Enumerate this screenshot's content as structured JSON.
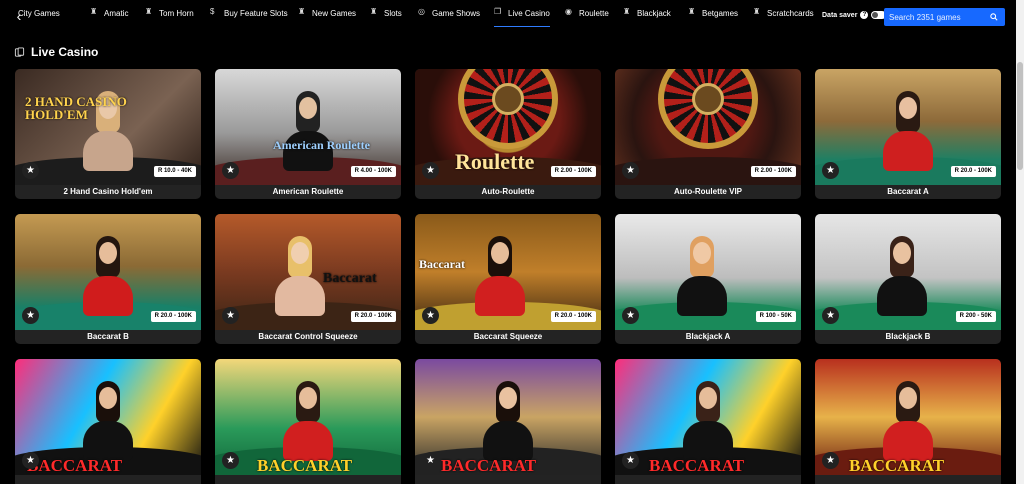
{
  "nav": {
    "back_icon": "chevron-left-icon",
    "items": [
      {
        "label": "City Games",
        "icon": "city-icon"
      },
      {
        "label": "Amatic",
        "icon": "trophy-icon"
      },
      {
        "label": "Tom Horn",
        "icon": "trophy-icon"
      },
      {
        "label": "Buy Feature Slots",
        "icon": "dollar-icon"
      },
      {
        "label": "New Games",
        "icon": "trophy-icon"
      },
      {
        "label": "Slots",
        "icon": "trophy-icon"
      },
      {
        "label": "Game Shows",
        "icon": "wheel-icon"
      },
      {
        "label": "Live Casino",
        "icon": "cards-icon"
      },
      {
        "label": "Roulette",
        "icon": "roulette-icon"
      },
      {
        "label": "Blackjack",
        "icon": "trophy-icon"
      },
      {
        "label": "Betgames",
        "icon": "trophy-icon"
      },
      {
        "label": "Scratchcards",
        "icon": "trophy-icon"
      }
    ],
    "active": "Live Casino",
    "data_saver_label": "Data saver",
    "search_placeholder": "Search 2351 games"
  },
  "section": {
    "title": "Live Casino"
  },
  "games": [
    {
      "name": "2 Hand Casino Hold'em",
      "limit": "R 10.0 - 40K",
      "logo": "2 HAND CASINO HOLD'EM"
    },
    {
      "name": "American Roulette",
      "limit": "R 4.00 - 100K",
      "logo": "American Roulette"
    },
    {
      "name": "Auto-Roulette",
      "limit": "R 2.00 - 100K",
      "logo": "Roulette"
    },
    {
      "name": "Auto-Roulette VIP",
      "limit": "R 2.00 - 100K",
      "logo": ""
    },
    {
      "name": "Baccarat A",
      "limit": "R 20.0 - 100K",
      "logo": ""
    },
    {
      "name": "Baccarat B",
      "limit": "R 20.0 - 100K",
      "logo": ""
    },
    {
      "name": "Baccarat Control Squeeze",
      "limit": "R 20.0 - 100K",
      "logo": "Baccarat"
    },
    {
      "name": "Baccarat Squeeze",
      "limit": "R 20.0 - 100K",
      "logo": "Baccarat"
    },
    {
      "name": "Blackjack A",
      "limit": "R 100 - 50K",
      "logo": ""
    },
    {
      "name": "Blackjack B",
      "limit": "R 200 - 50K",
      "logo": ""
    },
    {
      "name": "",
      "limit": "",
      "logo": "BACCARAT"
    },
    {
      "name": "",
      "limit": "",
      "logo": "BACCARAT"
    },
    {
      "name": "",
      "limit": "",
      "logo": "BACCARAT"
    },
    {
      "name": "",
      "limit": "",
      "logo": "BACCARAT"
    },
    {
      "name": "",
      "limit": "",
      "logo": "BACCARAT"
    }
  ],
  "colors": {
    "accent": "#1769ff",
    "background": "#000000",
    "card": "#232323"
  }
}
